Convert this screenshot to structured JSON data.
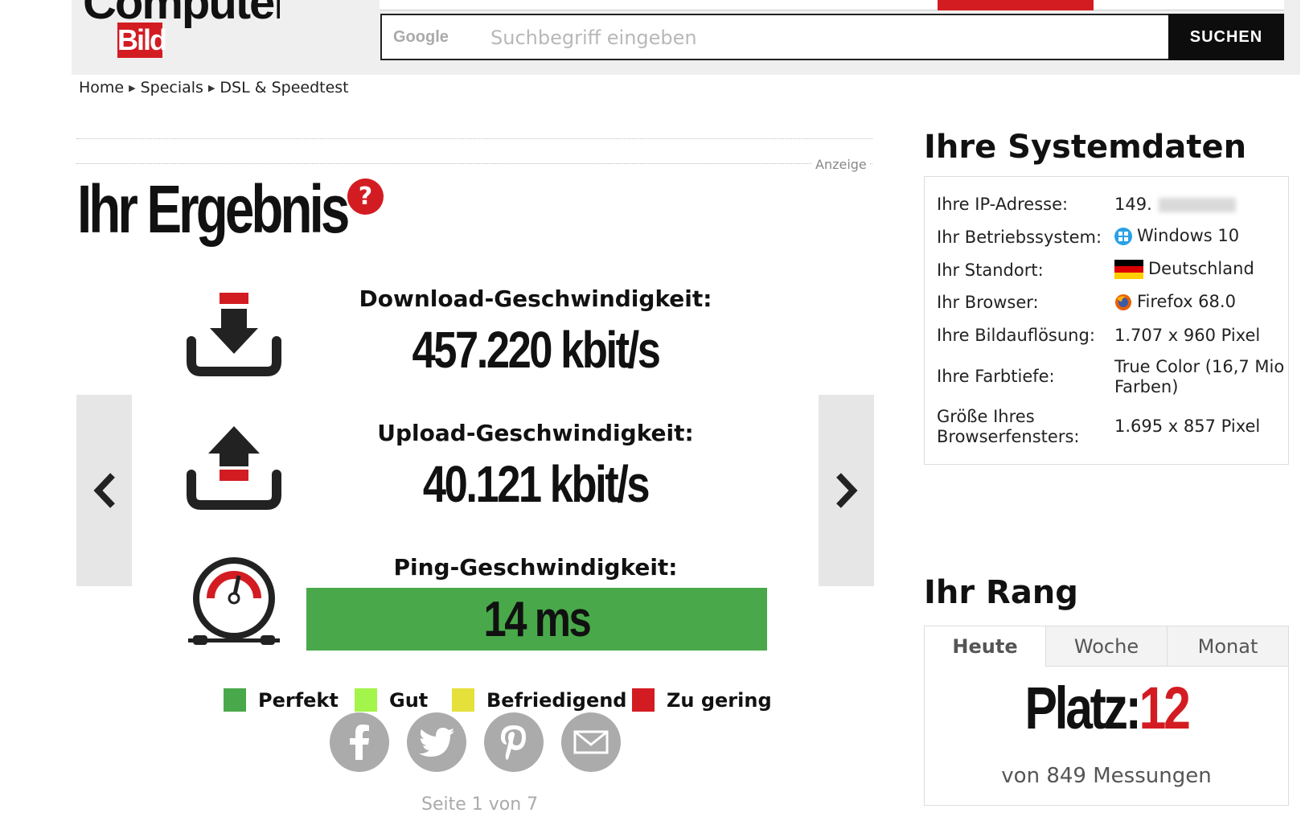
{
  "header": {
    "logo_top": "Computer",
    "logo_bottom": "Bild",
    "search_brand": "Google",
    "search_placeholder": "Suchbegriff eingeben",
    "search_button": "SUCHEN"
  },
  "breadcrumb": [
    "Home",
    "Specials",
    "DSL & Speedtest"
  ],
  "ad_label": "Anzeige",
  "result": {
    "title": "Ihr Ergebnis",
    "help": "?",
    "download_label": "Download-Geschwindigkeit:",
    "download_value": "457.220 kbit/s",
    "upload_label": "Upload-Geschwindigkeit:",
    "upload_value": "40.121 kbit/s",
    "ping_label": "Ping-Geschwindigkeit:",
    "ping_value": "14 ms",
    "ping_color": "#49a94a"
  },
  "legend": [
    {
      "label": "Perfekt",
      "color": "#49a94a"
    },
    {
      "label": "Gut",
      "color": "#a3f44b"
    },
    {
      "label": "Befriedigend",
      "color": "#e5e03a"
    },
    {
      "label": "Zu gering",
      "color": "#d31c22"
    }
  ],
  "share": [
    "facebook-icon",
    "twitter-icon",
    "pinterest-icon",
    "mail-icon"
  ],
  "pagination": "Seite 1 von 7",
  "system": {
    "heading": "Ihre Systemdaten",
    "rows": [
      {
        "label": "Ihre IP-Adresse:",
        "value": "149."
      },
      {
        "label": "Ihr Betriebssystem:",
        "value": "Windows 10"
      },
      {
        "label": "Ihr Standort:",
        "value": "Deutschland"
      },
      {
        "label": "Ihr Browser:",
        "value": "Firefox 68.0"
      },
      {
        "label": "Ihre Bildauflösung:",
        "value": "1.707 x 960 Pixel"
      },
      {
        "label": "Ihre Farbtiefe:",
        "value": "True Color (16,7 Mio Farben)"
      },
      {
        "label": "Größe Ihres Browserfensters:",
        "value": "1.695 x 857 Pixel"
      }
    ]
  },
  "rank": {
    "heading": "Ihr Rang",
    "tabs": [
      "Heute",
      "Woche",
      "Monat"
    ],
    "active_tab": "Heute",
    "place_label": "Platz:",
    "place_value": "12",
    "total": "von 849 Messungen"
  },
  "colors": {
    "accent": "#d31c22",
    "dark": "#0d0d0d",
    "panel": "#e6e6e6"
  }
}
